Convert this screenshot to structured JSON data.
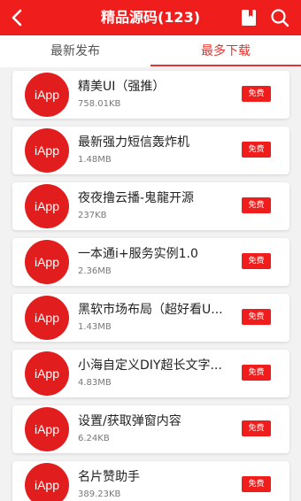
{
  "header": {
    "title": "精品源码(123)",
    "back_icon": "back-arrow-icon",
    "book_icon": "bookmark-icon",
    "search_icon": "search-icon",
    "color": "#f01d1d"
  },
  "tabs": [
    {
      "label": "最新发布",
      "active": false
    },
    {
      "label": "最多下载",
      "active": true
    }
  ],
  "items": [
    {
      "logo": "iApp",
      "name": "精美UI（强推）",
      "size": "758.01KB",
      "badge": "免费"
    },
    {
      "logo": "iApp",
      "name": "最新强力短信轰炸机",
      "size": "1.48MB",
      "badge": "免费"
    },
    {
      "logo": "iApp",
      "name": "夜夜撸云播-鬼龍开源",
      "size": "237KB",
      "badge": "免费"
    },
    {
      "logo": "iApp",
      "name": "一本通i+服务实例1.0",
      "size": "2.36MB",
      "badge": "免费"
    },
    {
      "logo": "iApp",
      "name": "黑软市场布局（超好看U...",
      "size": "1.43MB",
      "badge": "免费"
    },
    {
      "logo": "iApp",
      "name": "小海自定义DIY超长文字...",
      "size": "4.83MB",
      "badge": "免费"
    },
    {
      "logo": "iApp",
      "name": "设置/获取弹窗内容",
      "size": "6.24KB",
      "badge": "免费"
    },
    {
      "logo": "iApp",
      "name": "名片赞助手",
      "size": "389.23KB",
      "badge": "免费"
    }
  ]
}
